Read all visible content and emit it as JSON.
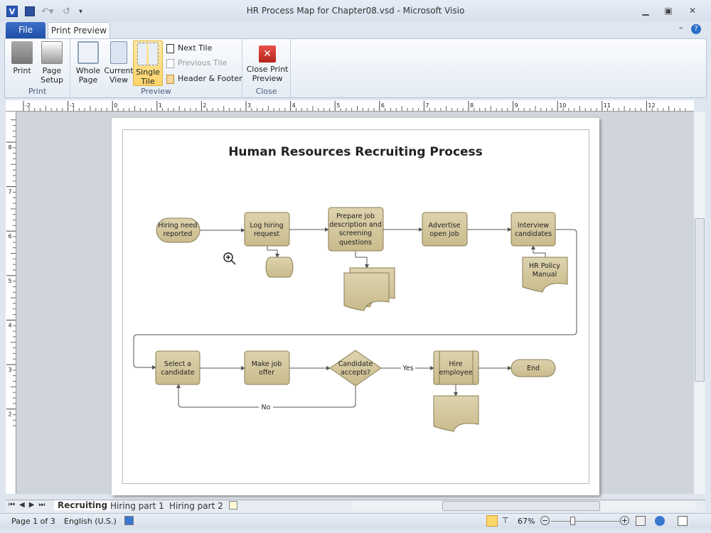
{
  "window": {
    "title": "HR Process Map for Chapter08.vsd - Microsoft Visio"
  },
  "tabs": {
    "file": "File",
    "print_preview": "Print Preview"
  },
  "ribbon": {
    "print_group": {
      "label": "Print",
      "print": "Print",
      "page_setup_1": "Page",
      "page_setup_2": "Setup"
    },
    "preview_group": {
      "label": "Preview",
      "whole_page_1": "Whole",
      "whole_page_2": "Page",
      "current_view_1": "Current",
      "current_view_2": "View",
      "single_tile_1": "Single",
      "single_tile_2": "Tile",
      "next_tile": "Next Tile",
      "previous_tile": "Previous Tile",
      "header_footer": "Header & Footer"
    },
    "close_group": {
      "label": "Close",
      "close_1": "Close Print",
      "close_2": "Preview"
    }
  },
  "ruler": {
    "h_ticks": [
      "-2",
      "-1",
      "0",
      "1",
      "2",
      "3",
      "4",
      "5",
      "6",
      "7",
      "8",
      "9",
      "10",
      "11",
      "12"
    ],
    "v_ticks": [
      "8",
      "7",
      "6",
      "5",
      "4",
      "3",
      "2"
    ]
  },
  "diagram": {
    "title": "Human Resources Recruiting Process",
    "hiring_need": [
      "Hiring need",
      "reported"
    ],
    "log_hiring": [
      "Log hiring",
      "request"
    ],
    "prepare_job": [
      "Prepare job",
      "description and",
      "screening",
      "questions"
    ],
    "advertise": [
      "Advertise",
      "open job"
    ],
    "interview": [
      "Interview",
      "candidates"
    ],
    "hr_policy": [
      "HR Policy",
      "Manual"
    ],
    "select": [
      "Select a",
      "candidate"
    ],
    "make_offer": [
      "Make job",
      "offer"
    ],
    "accepts": [
      "Candidate",
      "accepts?"
    ],
    "hire": [
      "Hire",
      "employee"
    ],
    "end": "End",
    "yes": "Yes",
    "no": "No",
    "shape_fill": "#d3c79f",
    "shape_stroke": "#8a7d55"
  },
  "sheets": {
    "tabs": [
      "Recruiting",
      "Hiring part 1",
      "Hiring part 2"
    ],
    "active": "Recruiting"
  },
  "status": {
    "page": "Page 1 of 3",
    "language": "English (U.S.)",
    "zoom": "67%",
    "zoom_level_percent": 67
  }
}
